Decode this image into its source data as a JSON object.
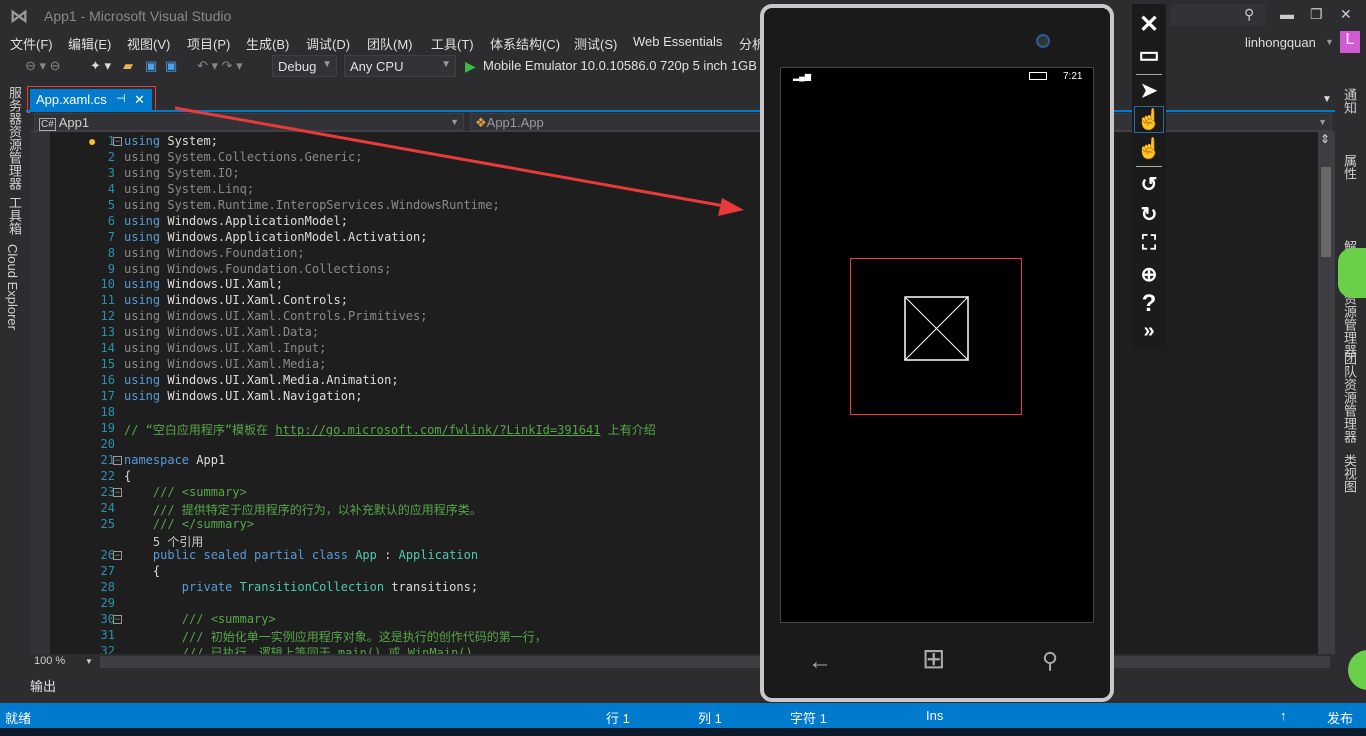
{
  "window": {
    "title": "App1 - Microsoft Visual Studio",
    "user": "linhongquan",
    "avatar": "L"
  },
  "menu": [
    "文件(F)",
    "编辑(E)",
    "视图(V)",
    "项目(P)",
    "生成(B)",
    "调试(D)",
    "团队(M)",
    "工具(T)",
    "体系结构(C)",
    "测试(S)",
    "Web Essentials",
    "分析"
  ],
  "toolbar": {
    "config": "Debug",
    "platform": "Any CPU",
    "run_target": "Mobile Emulator 10.0.10586.0 720p 5 inch 1GB"
  },
  "left_tabs": [
    "服务器资源管理器",
    "工具箱",
    "Cloud Explorer"
  ],
  "right_tabs": [
    "通知",
    "属性",
    "解决方案资源管理器",
    "团队资源管理器",
    "类视图"
  ],
  "tab": {
    "label": "App.xaml.cs",
    "pin": "⊣",
    "close": "✕"
  },
  "nav": {
    "project": "App1",
    "class": "App1.App"
  },
  "code": [
    {
      "n": "1",
      "s": [
        [
          "k",
          "using"
        ],
        [
          "",
          "System;"
        ]
      ],
      "f": "⊟"
    },
    {
      "n": "2",
      "s": [
        [
          "d",
          "using System.Collections.Generic;"
        ]
      ]
    },
    {
      "n": "3",
      "s": [
        [
          "d",
          "using System.IO;"
        ]
      ]
    },
    {
      "n": "4",
      "s": [
        [
          "d",
          "using System.Linq;"
        ]
      ]
    },
    {
      "n": "5",
      "s": [
        [
          "d",
          "using System.Runtime.InteropServices.WindowsRuntime;"
        ]
      ]
    },
    {
      "n": "6",
      "s": [
        [
          "k",
          "using"
        ],
        [
          "",
          "Windows.ApplicationModel;"
        ]
      ]
    },
    {
      "n": "7",
      "s": [
        [
          "k",
          "using"
        ],
        [
          "",
          "Windows.ApplicationModel.Activation;"
        ]
      ]
    },
    {
      "n": "8",
      "s": [
        [
          "d",
          "using Windows.Foundation;"
        ]
      ]
    },
    {
      "n": "9",
      "s": [
        [
          "d",
          "using Windows.Foundation.Collections;"
        ]
      ]
    },
    {
      "n": "10",
      "s": [
        [
          "k",
          "using"
        ],
        [
          "",
          "Windows.UI.Xaml;"
        ]
      ]
    },
    {
      "n": "11",
      "s": [
        [
          "k",
          "using"
        ],
        [
          "",
          "Windows.UI.Xaml.Controls;"
        ]
      ]
    },
    {
      "n": "12",
      "s": [
        [
          "d",
          "using Windows.UI.Xaml.Controls.Primitives;"
        ]
      ]
    },
    {
      "n": "13",
      "s": [
        [
          "d",
          "using Windows.UI.Xaml.Data;"
        ]
      ]
    },
    {
      "n": "14",
      "s": [
        [
          "d",
          "using Windows.UI.Xaml.Input;"
        ]
      ]
    },
    {
      "n": "15",
      "s": [
        [
          "d",
          "using Windows.UI.Xaml.Media;"
        ]
      ]
    },
    {
      "n": "16",
      "s": [
        [
          "k",
          "using"
        ],
        [
          "",
          "Windows.UI.Xaml.Media.Animation;"
        ]
      ]
    },
    {
      "n": "17",
      "s": [
        [
          "k",
          "using"
        ],
        [
          "",
          "Windows.UI.Xaml.Navigation;"
        ]
      ]
    },
    {
      "n": "18",
      "s": []
    },
    {
      "n": "19",
      "s": [
        [
          "c",
          "// “空白应用程序”模板在 "
        ],
        [
          "u",
          "http://go.microsoft.com/fwlink/?LinkId=391641"
        ],
        [
          "c",
          " 上有介绍"
        ]
      ]
    },
    {
      "n": "20",
      "s": []
    },
    {
      "n": "21",
      "s": [
        [
          "k",
          "namespace"
        ],
        [
          "",
          "App1"
        ]
      ],
      "f": "⊟"
    },
    {
      "n": "22",
      "s": [
        [
          "",
          "{"
        ]
      ]
    },
    {
      "n": "23",
      "s": [
        [
          "c",
          "    /// <summary>"
        ]
      ],
      "f": "⊟"
    },
    {
      "n": "24",
      "s": [
        [
          "c",
          "    /// 提供特定于应用程序的行为，以补充默认的应用程序类。"
        ]
      ]
    },
    {
      "n": "25",
      "s": [
        [
          "c",
          "    /// </summary>"
        ]
      ]
    },
    {
      "n": "",
      "s": [
        [
          "ref",
          "    5 个引用"
        ]
      ]
    },
    {
      "n": "26",
      "s": [
        [
          "k",
          "    public sealed partial class"
        ],
        [
          "t",
          "App"
        ],
        [
          "",
          ":"
        ],
        [
          "t",
          "Application"
        ]
      ],
      "f": "⊟"
    },
    {
      "n": "27",
      "s": [
        [
          "",
          "    {"
        ]
      ]
    },
    {
      "n": "28",
      "s": [
        [
          "k",
          "        private"
        ],
        [
          "t",
          "TransitionCollection"
        ],
        [
          "",
          "transitions;"
        ]
      ]
    },
    {
      "n": "29",
      "s": []
    },
    {
      "n": "30",
      "s": [
        [
          "c",
          "        /// <summary>"
        ]
      ],
      "f": "⊟"
    },
    {
      "n": "31",
      "s": [
        [
          "c",
          "        /// 初始化单一实例应用程序对象。这是执行的创作代码的第一行，"
        ]
      ]
    },
    {
      "n": "32",
      "s": [
        [
          "c",
          "        /// 已执行，逻辑上等同于 main() 或 WinMain()。"
        ]
      ]
    }
  ],
  "zoom": "100 %",
  "output_label": "输出",
  "status": {
    "ready": "就绪",
    "line": "行 1",
    "col": "列 1",
    "char": "字符 1",
    "mode": "Ins",
    "publish": "发布"
  },
  "emulator": {
    "time": "7:21",
    "tools": [
      "close",
      "minimize",
      "pointer",
      "single-touch",
      "multi-touch",
      "rotate-left",
      "rotate-right",
      "fit-to-screen",
      "zoom",
      "help",
      "more-tools"
    ]
  },
  "colors": {
    "accent": "#007acc",
    "annotation": "#e83a3a",
    "keyword": "#569cd6",
    "type": "#4ec9b0",
    "comment": "#57a64a"
  }
}
